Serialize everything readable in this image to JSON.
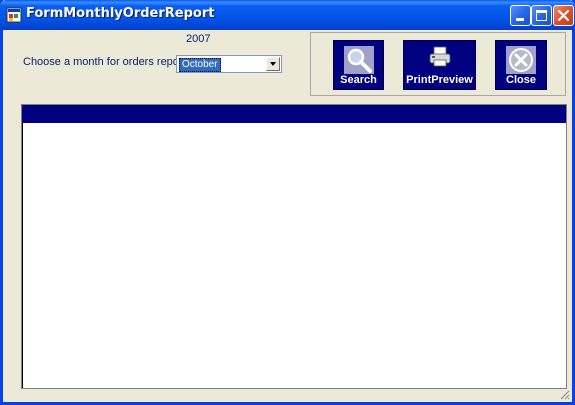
{
  "window": {
    "title": "FormMonthlyOrderReport"
  },
  "report": {
    "year": "2007",
    "month_label": "Choose a month for orders report at",
    "month_selected": "October"
  },
  "buttons": {
    "search": "Search",
    "print_preview": "PrintPreview",
    "close": "Close"
  },
  "colors": {
    "title_bar": "#0254e8",
    "button_bg": "#000080",
    "grid_header": "#000080",
    "selection": "#316ac5"
  }
}
